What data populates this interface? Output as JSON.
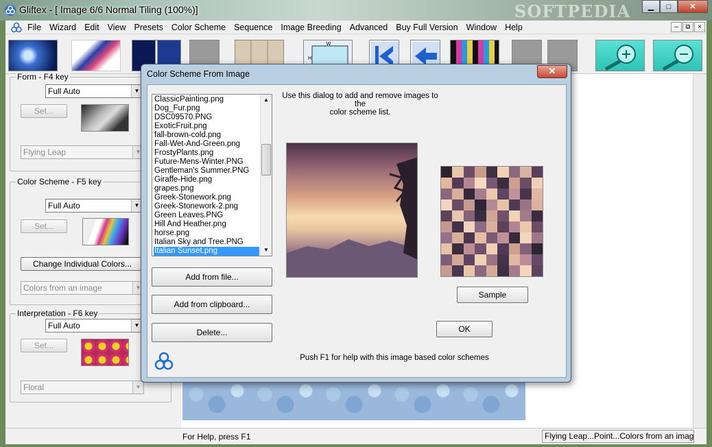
{
  "window": {
    "title": "Gliftex - [ Image 6/6 Normal Tiling (100%)]",
    "watermark": "SOFTPEDIA",
    "minimize": "▁",
    "maximize": "□",
    "close": "✕"
  },
  "menubar": {
    "items": [
      "File",
      "Wizard",
      "Edit",
      "View",
      "Presets",
      "Color Scheme",
      "Sequence",
      "Image Breeding",
      "Advanced",
      "Buy Full Version",
      "Window",
      "Help"
    ],
    "mdi_minimize": "–",
    "mdi_restore": "⧉",
    "mdi_close": "×"
  },
  "left_panel": {
    "form": {
      "label": "Form - F4 key",
      "select_value": "Full Auto",
      "set_label": "Set...",
      "preset_value": "Flying Leap"
    },
    "color_scheme": {
      "label": "Color Scheme - F5 key",
      "select_value": "Full Auto",
      "set_label": "Set...",
      "change_colors_label": "Change Individual Colors...",
      "preset_value": "Colors from an image"
    },
    "interpretation": {
      "label": "Interpretation - F6 key",
      "select_value": "Full Auto",
      "set_label": "Set...",
      "preset_value": "Floral"
    }
  },
  "status": {
    "help": "For Help, press F1",
    "info": "Flying Leap...Point...Colors from an imag"
  },
  "dialog": {
    "title": "Color Scheme From Image",
    "close": "✕",
    "files": [
      "ClassicPainting.png",
      "Dog_Fur.png",
      "DSC09570.PNG",
      "ExoticFruit.png",
      "fall-brown-cold.png",
      "Fall-Wet-And-Green.png",
      "FrostyPlants.png",
      "Future-Mens-Winter.PNG",
      "Gentleman's Summer.PNG",
      "Giraffe-Hide.png",
      "grapes.png",
      "Greek-Stonework.png",
      "Greek-Stonework-2.png",
      "Green Leaves.PNG",
      "Hill And Heather.png",
      "horse.png",
      "Italian Sky and Tree.PNG",
      "Italian Sunset.png"
    ],
    "selected_index": 17,
    "add_file_label": "Add from file...",
    "add_clipboard_label": "Add from clipboard...",
    "delete_label": "Delete...",
    "info_line1": "Use this dialog to add and remove images to the",
    "info_line2": "color scheme list.",
    "sample_label": "Sample",
    "ok_label": "OK",
    "help_text": "Push F1 for help with this image based color schemes"
  },
  "colors": {
    "dialog_frame": "#b8cfe2",
    "selection": "#3399ff",
    "mosaic": [
      "#2b2330",
      "#e9c6a8",
      "#6f4b66",
      "#c99b8a",
      "#412f46",
      "#f0d3b0",
      "#8b6a80",
      "#d6b3a5",
      "#5a3f58",
      "#e4b79a",
      "#553b55",
      "#b38691",
      "#f5dcc0",
      "#7a5873",
      "#3c2c40",
      "#cfa08f",
      "#6b4c68",
      "#efd0b6",
      "#8c667f",
      "#d8ae9c",
      "#332838",
      "#a77c8c",
      "#ecc9ae",
      "#5e4560",
      "#c2929a",
      "#47334b",
      "#e0b7a0",
      "#f2d6bc",
      "#6a4b66",
      "#c79a8f",
      "#2f2534",
      "#b48a95",
      "#e7c1a6",
      "#4e3a52",
      "#9a7487",
      "#dcb29e",
      "#5b425d",
      "#e9c8ae",
      "#85627a",
      "#3b2d41",
      "#d1a696",
      "#724f6b",
      "#f0d2b5",
      "#a4798a",
      "#3a2c3e",
      "#c6998f",
      "#41314a",
      "#efd4bb",
      "#8d6a81",
      "#dbb09c",
      "#5c4259",
      "#b28594",
      "#ecc8ab",
      "#6a4c65",
      "#93708a",
      "#d9ae9a",
      "#4b3650",
      "#e3bea5",
      "#7b5a75",
      "#c09296",
      "#382a3d",
      "#f1d6bd",
      "#a07789",
      "#e6c3a7",
      "#3a2d40",
      "#bd8e98",
      "#6f516c",
      "#efd0b3",
      "#51395a",
      "#cda291",
      "#84617b",
      "#2e2533",
      "#7c5c77",
      "#d4a897",
      "#5e4460",
      "#f0d3b7",
      "#9c7486",
      "#43344a",
      "#e1b9a2",
      "#b98c98",
      "#664966",
      "#c89a91",
      "#4a3650",
      "#e9c6aa",
      "#8a6880",
      "#d7ab9b",
      "#3d2e43",
      "#a77d8e",
      "#f2d5ba",
      "#5d4360"
    ]
  }
}
